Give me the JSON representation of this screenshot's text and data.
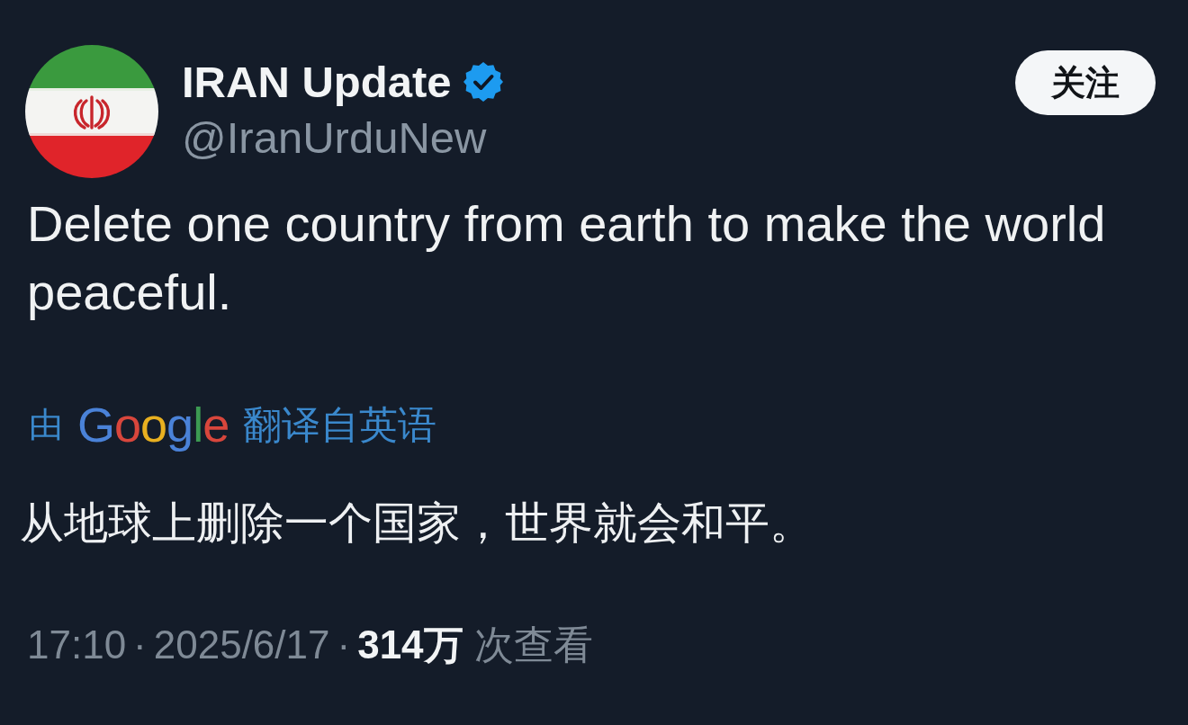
{
  "author": {
    "name": "IRAN Update",
    "verified": true,
    "handle": "@IranUrduNew"
  },
  "follow_button": {
    "label": "关注"
  },
  "tweet": {
    "text": "Delete one country from earth to make the world peaceful."
  },
  "translation": {
    "prefix": "由",
    "provider": "Google",
    "suffix": "翻译自英语",
    "text": "从地球上删除一个国家，世界就会和平。"
  },
  "meta": [
    {
      "kind": "time",
      "text": "17:10"
    },
    {
      "kind": "separator",
      "text": "·"
    },
    {
      "kind": "date",
      "text": "2025/6/17"
    },
    {
      "kind": "separator",
      "text": "·"
    },
    {
      "kind": "views",
      "text": "314万"
    },
    {
      "kind": "label",
      "text": "次查看"
    }
  ]
}
